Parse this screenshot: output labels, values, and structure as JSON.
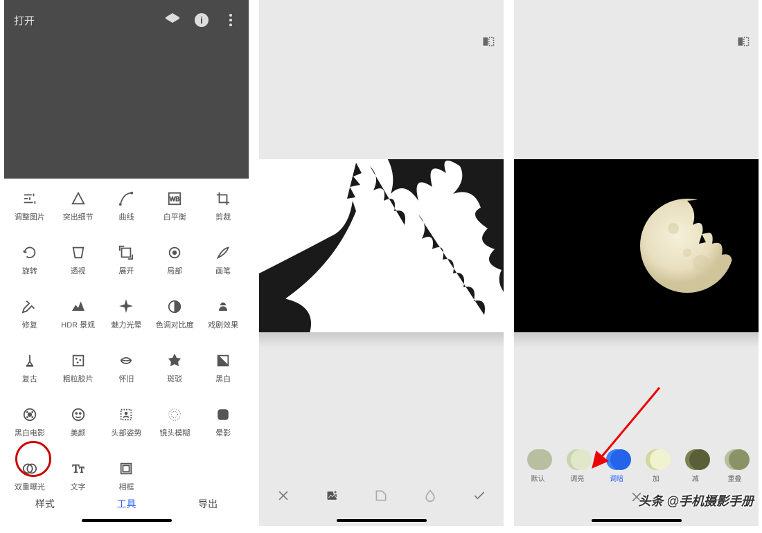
{
  "screen1": {
    "title": "打开",
    "tools": [
      {
        "label": "调整图片"
      },
      {
        "label": "突出细节"
      },
      {
        "label": "曲线"
      },
      {
        "label": "白平衡"
      },
      {
        "label": "剪裁"
      },
      {
        "label": "旋转"
      },
      {
        "label": "透视"
      },
      {
        "label": "展开"
      },
      {
        "label": "局部"
      },
      {
        "label": "画笔"
      },
      {
        "label": "修复"
      },
      {
        "label": "HDR 景观"
      },
      {
        "label": "魅力光晕"
      },
      {
        "label": "色调对比度"
      },
      {
        "label": "戏剧效果"
      },
      {
        "label": "复古"
      },
      {
        "label": "粗粒胶片"
      },
      {
        "label": "怀旧"
      },
      {
        "label": "斑驳"
      },
      {
        "label": "黑白"
      },
      {
        "label": "黑白电影"
      },
      {
        "label": "美颜"
      },
      {
        "label": "头部姿势"
      },
      {
        "label": "镜头模糊"
      },
      {
        "label": "晕影"
      },
      {
        "label": "双重曝光"
      },
      {
        "label": "文字"
      },
      {
        "label": "相框"
      }
    ],
    "highlighted_tool": "双重曝光",
    "bottom_tabs": {
      "styles": "样式",
      "tools": "工具",
      "export": "导出",
      "active": "tools"
    }
  },
  "screen3": {
    "blend_modes": [
      {
        "label": "默认"
      },
      {
        "label": "调亮"
      },
      {
        "label": "调暗"
      },
      {
        "label": "加"
      },
      {
        "label": "减"
      },
      {
        "label": "重叠"
      }
    ],
    "active_blend": "调暗"
  },
  "watermark": "头条 @手机摄影手册"
}
